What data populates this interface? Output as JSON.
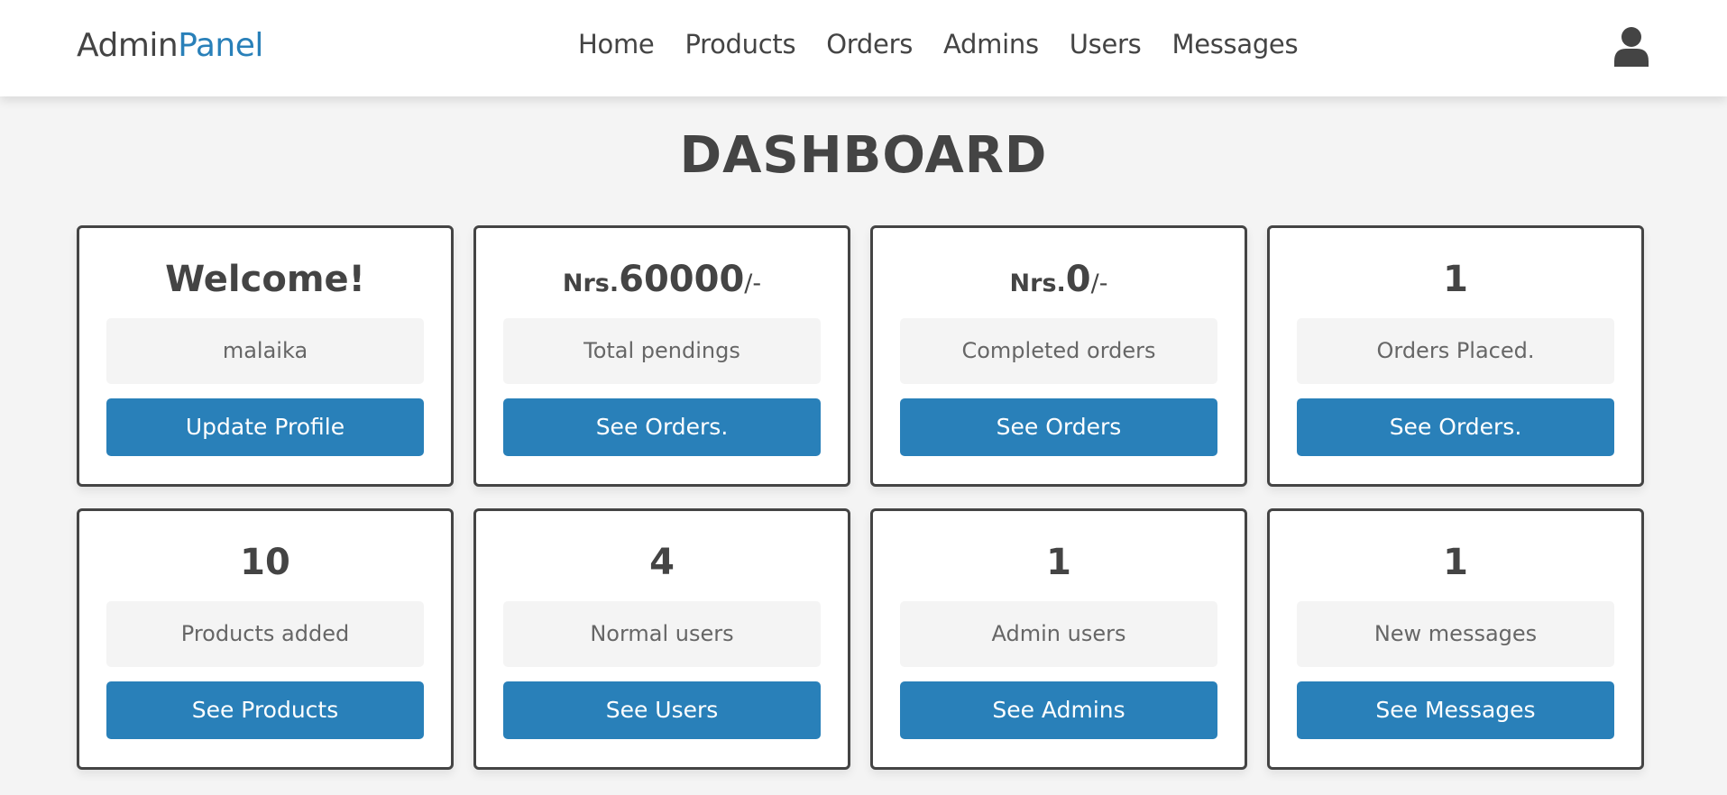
{
  "header": {
    "logo_main": "Admin",
    "logo_accent": "Panel",
    "nav": [
      "Home",
      "Products",
      "Orders",
      "Admins",
      "Users",
      "Messages"
    ],
    "user_icon": "user-icon"
  },
  "page_title": "DASHBOARD",
  "cards": [
    {
      "head": "Welcome!",
      "label": "malaika",
      "button": "Update Profile"
    },
    {
      "currency": "Nrs.",
      "amount": "60000",
      "suffix": "/-",
      "label": "Total pendings",
      "button": "See Orders."
    },
    {
      "currency": "Nrs.",
      "amount": "0",
      "suffix": "/-",
      "label": "Completed orders",
      "button": "See Orders"
    },
    {
      "head": "1",
      "label": "Orders Placed.",
      "button": "See Orders."
    },
    {
      "head": "10",
      "label": "Products added",
      "button": "See Products"
    },
    {
      "head": "4",
      "label": "Normal users",
      "button": "See Users"
    },
    {
      "head": "1",
      "label": "Admin users",
      "button": "See Admins"
    },
    {
      "head": "1",
      "label": "New messages",
      "button": "See Messages"
    }
  ],
  "colors": {
    "accent": "#2980b9",
    "text": "#444444",
    "background": "#f4f4f4"
  }
}
